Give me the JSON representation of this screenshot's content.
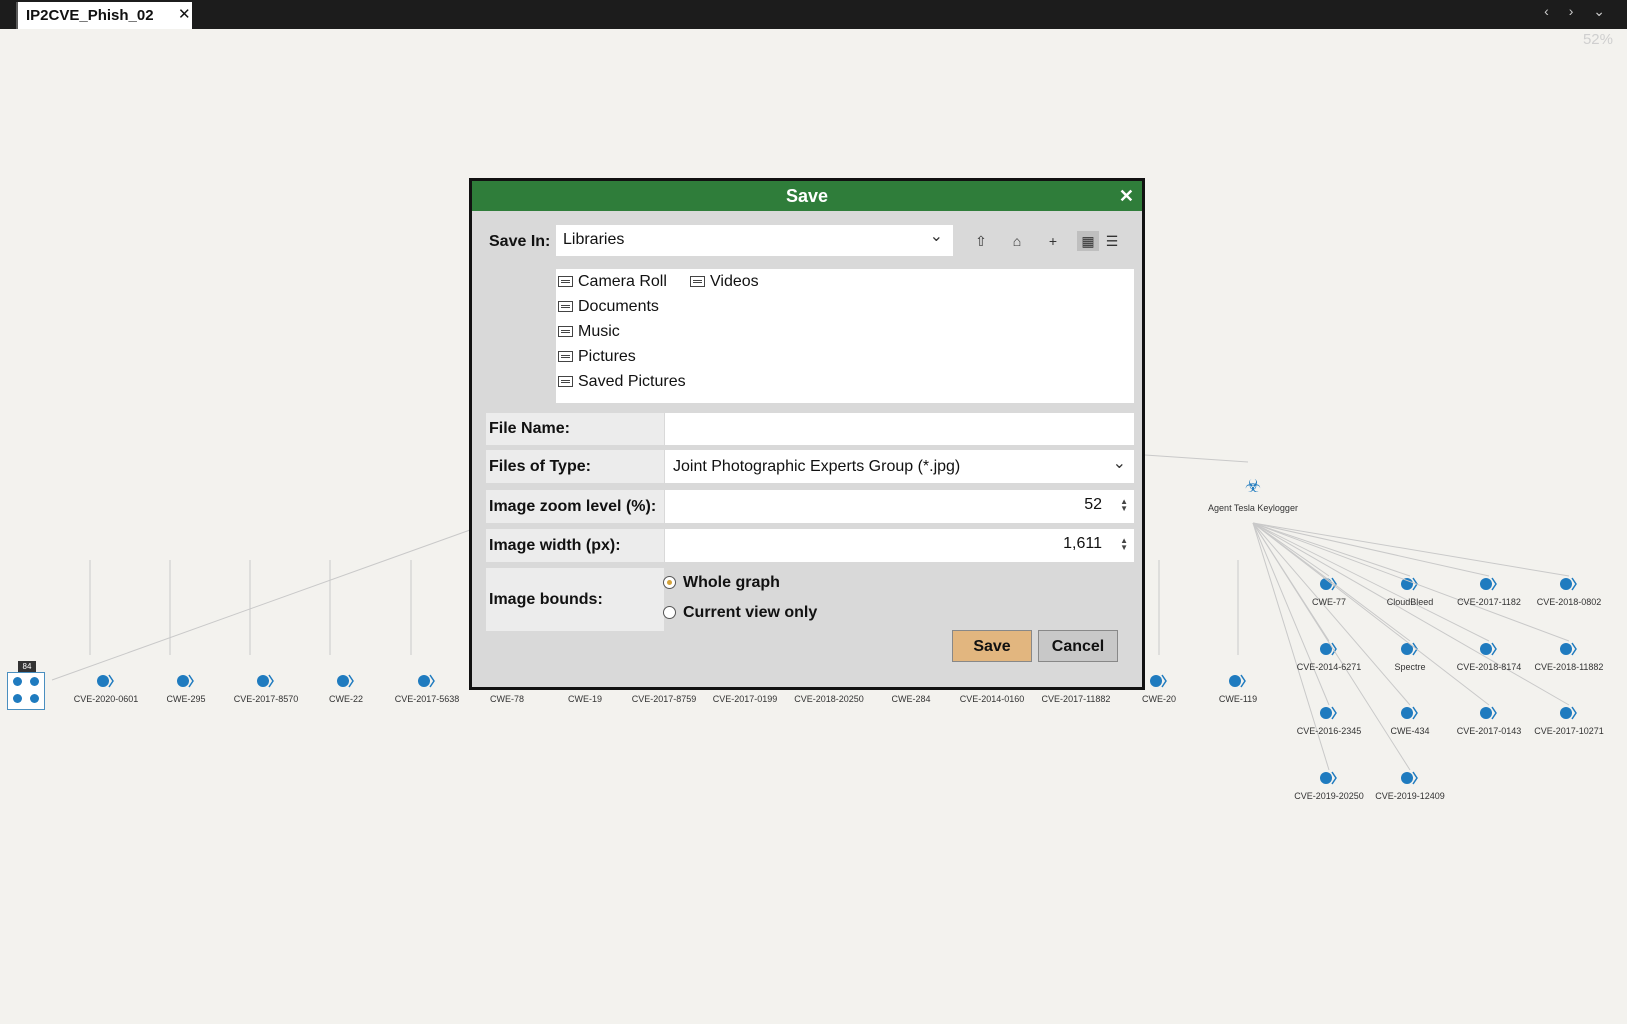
{
  "tab": {
    "title": "IP2CVE_Phish_02",
    "close": "✕"
  },
  "nav": {
    "arrows": "‹ › ⌄"
  },
  "zoom_readout": "52%",
  "graph": {
    "hub_label": "Agent Tesla Keylogger",
    "group_badge": "84",
    "bottom_nodes": [
      "CVE-2020-0601",
      "CWE-295",
      "CVE-2017-8570",
      "CWE-22",
      "CVE-2017-5638",
      "CWE-78",
      "CWE-19",
      "CVE-2017-8759",
      "CVE-2017-0199",
      "CVE-2018-20250",
      "CWE-284",
      "CVE-2014-0160",
      "CVE-2017-11882",
      "CWE-20",
      "CWE-119"
    ],
    "right_nodes": [
      "CWE-77",
      "CloudBleed",
      "CVE-2017-1182",
      "CVE-2018-0802",
      "CVE-2014-6271",
      "Spectre",
      "CVE-2018-8174",
      "CVE-2018-11882",
      "CVE-2016-2345",
      "CWE-434",
      "CVE-2017-0143",
      "CVE-2017-10271",
      "CVE-2019-20250",
      "CVE-2019-12409"
    ]
  },
  "dialog": {
    "title": "Save",
    "close": "✕",
    "save_in_label": "Save In:",
    "save_in_value": "Libraries",
    "toolbar_icons": [
      "up-folder-icon",
      "home-icon",
      "new-folder-icon",
      "grid-view-icon",
      "list-view-icon"
    ],
    "files": [
      "Camera Roll",
      "Documents",
      "Music",
      "Pictures",
      "Saved Pictures",
      "Videos"
    ],
    "file_name_label": "File Name:",
    "file_name_value": "",
    "file_type_label": "Files of Type:",
    "file_type_value": "Joint Photographic Experts Group (*.jpg)",
    "zoom_label": "Image zoom level (%):",
    "zoom_value": "52",
    "width_label": "Image width (px):",
    "width_value": "1,611",
    "bounds_label": "Image bounds:",
    "bounds_options": [
      "Whole graph",
      "Current view only"
    ],
    "bounds_selected": "Whole graph",
    "save_button": "Save",
    "cancel_button": "Cancel"
  },
  "colors": {
    "title_bar": "#2f7d3a",
    "save_button": "#e2b67f",
    "node_blue": "#1f7bbf"
  }
}
